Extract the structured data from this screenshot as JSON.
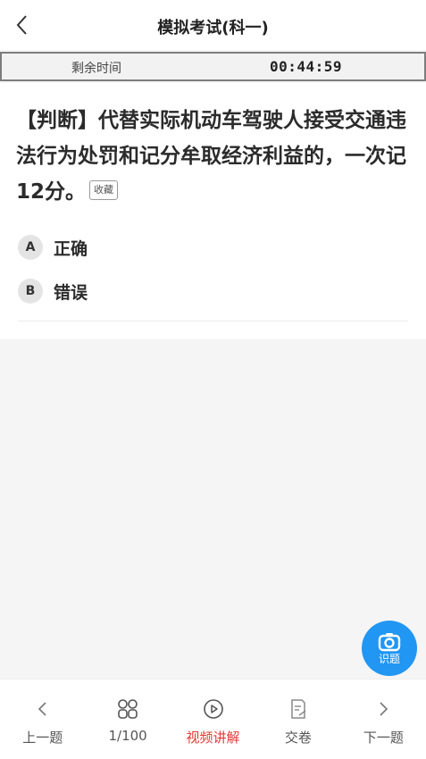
{
  "header": {
    "title": "模拟考试(科一)"
  },
  "timer": {
    "label": "剩余时间",
    "value": "00:44:59"
  },
  "question": {
    "text": "【判断】代替实际机动车驾驶人接受交通违法行为处罚和记分牟取经济利益的，一次记12分。",
    "favorite_label": "收藏"
  },
  "options": [
    {
      "key": "A",
      "text": "正确"
    },
    {
      "key": "B",
      "text": "错误"
    }
  ],
  "recognize": {
    "label": "识题",
    "icon": "camera-icon"
  },
  "bottom_nav": {
    "prev": {
      "label": "上一题",
      "icon": "chevron-left-icon"
    },
    "progress": {
      "label": "1/100",
      "icon": "grid-icon"
    },
    "video": {
      "label": "视频讲解",
      "icon": "play-circle-icon",
      "color": "#e53935"
    },
    "submit": {
      "label": "交卷",
      "icon": "document-edit-icon"
    },
    "next": {
      "label": "下一题",
      "icon": "chevron-right-icon"
    }
  },
  "colors": {
    "accent_blue": "#2196f3",
    "active_red": "#e53935"
  }
}
